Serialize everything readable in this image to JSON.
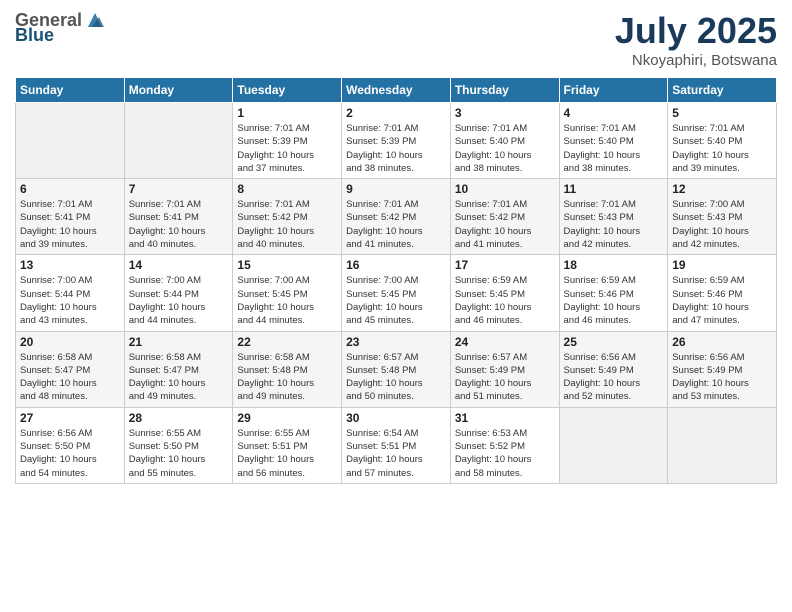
{
  "header": {
    "logo_general": "General",
    "logo_blue": "Blue",
    "title": "July 2025",
    "location": "Nkoyaphiri, Botswana"
  },
  "days_of_week": [
    "Sunday",
    "Monday",
    "Tuesday",
    "Wednesday",
    "Thursday",
    "Friday",
    "Saturday"
  ],
  "weeks": [
    [
      {
        "day": "",
        "info": ""
      },
      {
        "day": "",
        "info": ""
      },
      {
        "day": "1",
        "info": "Sunrise: 7:01 AM\nSunset: 5:39 PM\nDaylight: 10 hours\nand 37 minutes."
      },
      {
        "day": "2",
        "info": "Sunrise: 7:01 AM\nSunset: 5:39 PM\nDaylight: 10 hours\nand 38 minutes."
      },
      {
        "day": "3",
        "info": "Sunrise: 7:01 AM\nSunset: 5:40 PM\nDaylight: 10 hours\nand 38 minutes."
      },
      {
        "day": "4",
        "info": "Sunrise: 7:01 AM\nSunset: 5:40 PM\nDaylight: 10 hours\nand 38 minutes."
      },
      {
        "day": "5",
        "info": "Sunrise: 7:01 AM\nSunset: 5:40 PM\nDaylight: 10 hours\nand 39 minutes."
      }
    ],
    [
      {
        "day": "6",
        "info": "Sunrise: 7:01 AM\nSunset: 5:41 PM\nDaylight: 10 hours\nand 39 minutes."
      },
      {
        "day": "7",
        "info": "Sunrise: 7:01 AM\nSunset: 5:41 PM\nDaylight: 10 hours\nand 40 minutes."
      },
      {
        "day": "8",
        "info": "Sunrise: 7:01 AM\nSunset: 5:42 PM\nDaylight: 10 hours\nand 40 minutes."
      },
      {
        "day": "9",
        "info": "Sunrise: 7:01 AM\nSunset: 5:42 PM\nDaylight: 10 hours\nand 41 minutes."
      },
      {
        "day": "10",
        "info": "Sunrise: 7:01 AM\nSunset: 5:42 PM\nDaylight: 10 hours\nand 41 minutes."
      },
      {
        "day": "11",
        "info": "Sunrise: 7:01 AM\nSunset: 5:43 PM\nDaylight: 10 hours\nand 42 minutes."
      },
      {
        "day": "12",
        "info": "Sunrise: 7:00 AM\nSunset: 5:43 PM\nDaylight: 10 hours\nand 42 minutes."
      }
    ],
    [
      {
        "day": "13",
        "info": "Sunrise: 7:00 AM\nSunset: 5:44 PM\nDaylight: 10 hours\nand 43 minutes."
      },
      {
        "day": "14",
        "info": "Sunrise: 7:00 AM\nSunset: 5:44 PM\nDaylight: 10 hours\nand 44 minutes."
      },
      {
        "day": "15",
        "info": "Sunrise: 7:00 AM\nSunset: 5:45 PM\nDaylight: 10 hours\nand 44 minutes."
      },
      {
        "day": "16",
        "info": "Sunrise: 7:00 AM\nSunset: 5:45 PM\nDaylight: 10 hours\nand 45 minutes."
      },
      {
        "day": "17",
        "info": "Sunrise: 6:59 AM\nSunset: 5:45 PM\nDaylight: 10 hours\nand 46 minutes."
      },
      {
        "day": "18",
        "info": "Sunrise: 6:59 AM\nSunset: 5:46 PM\nDaylight: 10 hours\nand 46 minutes."
      },
      {
        "day": "19",
        "info": "Sunrise: 6:59 AM\nSunset: 5:46 PM\nDaylight: 10 hours\nand 47 minutes."
      }
    ],
    [
      {
        "day": "20",
        "info": "Sunrise: 6:58 AM\nSunset: 5:47 PM\nDaylight: 10 hours\nand 48 minutes."
      },
      {
        "day": "21",
        "info": "Sunrise: 6:58 AM\nSunset: 5:47 PM\nDaylight: 10 hours\nand 49 minutes."
      },
      {
        "day": "22",
        "info": "Sunrise: 6:58 AM\nSunset: 5:48 PM\nDaylight: 10 hours\nand 49 minutes."
      },
      {
        "day": "23",
        "info": "Sunrise: 6:57 AM\nSunset: 5:48 PM\nDaylight: 10 hours\nand 50 minutes."
      },
      {
        "day": "24",
        "info": "Sunrise: 6:57 AM\nSunset: 5:49 PM\nDaylight: 10 hours\nand 51 minutes."
      },
      {
        "day": "25",
        "info": "Sunrise: 6:56 AM\nSunset: 5:49 PM\nDaylight: 10 hours\nand 52 minutes."
      },
      {
        "day": "26",
        "info": "Sunrise: 6:56 AM\nSunset: 5:49 PM\nDaylight: 10 hours\nand 53 minutes."
      }
    ],
    [
      {
        "day": "27",
        "info": "Sunrise: 6:56 AM\nSunset: 5:50 PM\nDaylight: 10 hours\nand 54 minutes."
      },
      {
        "day": "28",
        "info": "Sunrise: 6:55 AM\nSunset: 5:50 PM\nDaylight: 10 hours\nand 55 minutes."
      },
      {
        "day": "29",
        "info": "Sunrise: 6:55 AM\nSunset: 5:51 PM\nDaylight: 10 hours\nand 56 minutes."
      },
      {
        "day": "30",
        "info": "Sunrise: 6:54 AM\nSunset: 5:51 PM\nDaylight: 10 hours\nand 57 minutes."
      },
      {
        "day": "31",
        "info": "Sunrise: 6:53 AM\nSunset: 5:52 PM\nDaylight: 10 hours\nand 58 minutes."
      },
      {
        "day": "",
        "info": ""
      },
      {
        "day": "",
        "info": ""
      }
    ]
  ]
}
